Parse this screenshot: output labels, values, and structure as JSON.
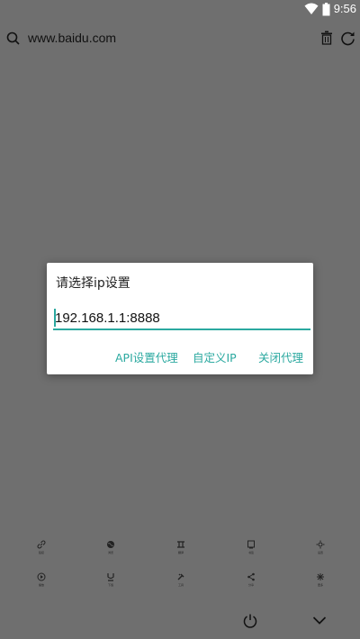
{
  "status_bar": {
    "time": "9:56",
    "icons": [
      "wifi-icon",
      "battery-icon"
    ]
  },
  "url_bar": {
    "url": "www.baidu.com",
    "icons": [
      "search-icon",
      "trash-icon",
      "refresh-icon"
    ]
  },
  "dialog": {
    "title": "请选择ip设置",
    "input_value": "192.168.1.1:8888",
    "buttons": {
      "api": "API设置代理",
      "custom": "自定义IP",
      "close": "关闭代理"
    }
  },
  "bottom_toolbar": {
    "row1": [
      {
        "icon": "link-icon",
        "label": "链接"
      },
      {
        "icon": "globe-icon",
        "label": "浏览"
      },
      {
        "icon": "translate-icon",
        "label": "翻译"
      },
      {
        "icon": "bookmark-icon",
        "label": "书签"
      },
      {
        "icon": "settings-icon",
        "label": "设置"
      }
    ],
    "row2": [
      {
        "icon": "play-icon",
        "label": "播放"
      },
      {
        "icon": "download-icon",
        "label": "下载"
      },
      {
        "icon": "tools-icon",
        "label": "工具"
      },
      {
        "icon": "share-icon",
        "label": "分享"
      },
      {
        "icon": "more-icon",
        "label": "更多"
      }
    ]
  },
  "bottom_icons": [
    "power-icon",
    "chevron-down-icon"
  ],
  "colors": {
    "accent": "#2ba9a0",
    "overlay": "#6f6f6f"
  }
}
